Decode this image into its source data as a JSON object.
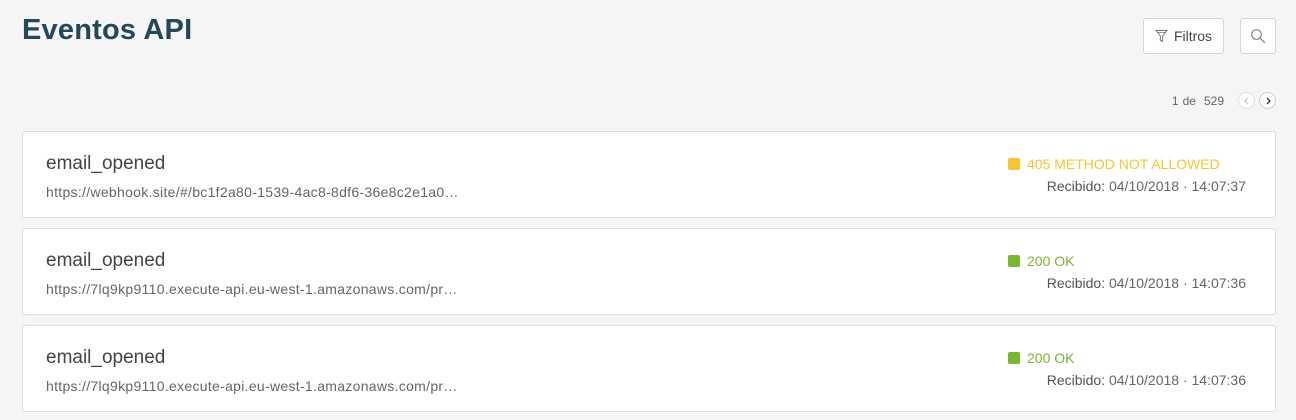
{
  "header": {
    "title": "Eventos API",
    "filter_label": "Filtros"
  },
  "pagination": {
    "current": "1",
    "separator": "de",
    "total": "529"
  },
  "received_label": "Recibido:",
  "colors": {
    "title": "#24475a",
    "warning": "#f7c531",
    "success": "#7ab62e"
  },
  "events": [
    {
      "name": "email_opened",
      "url": "https://webhook.site/#/bc1f2a80-1539-4ac8-8df6-36e8c2e1a0…",
      "status": "405 METHOD NOT ALLOWED",
      "status_color": "#f7c531",
      "received": "04/10/2018 · 14:07:37"
    },
    {
      "name": "email_opened",
      "url": "https://7lq9kp9110.execute-api.eu-west-1.amazonaws.com/pr…",
      "status": "200 OK",
      "status_color": "#7ab62e",
      "received": "04/10/2018 · 14:07:36"
    },
    {
      "name": "email_opened",
      "url": "https://7lq9kp9110.execute-api.eu-west-1.amazonaws.com/pr…",
      "status": "200 OK",
      "status_color": "#7ab62e",
      "received": "04/10/2018 · 14:07:36"
    }
  ]
}
